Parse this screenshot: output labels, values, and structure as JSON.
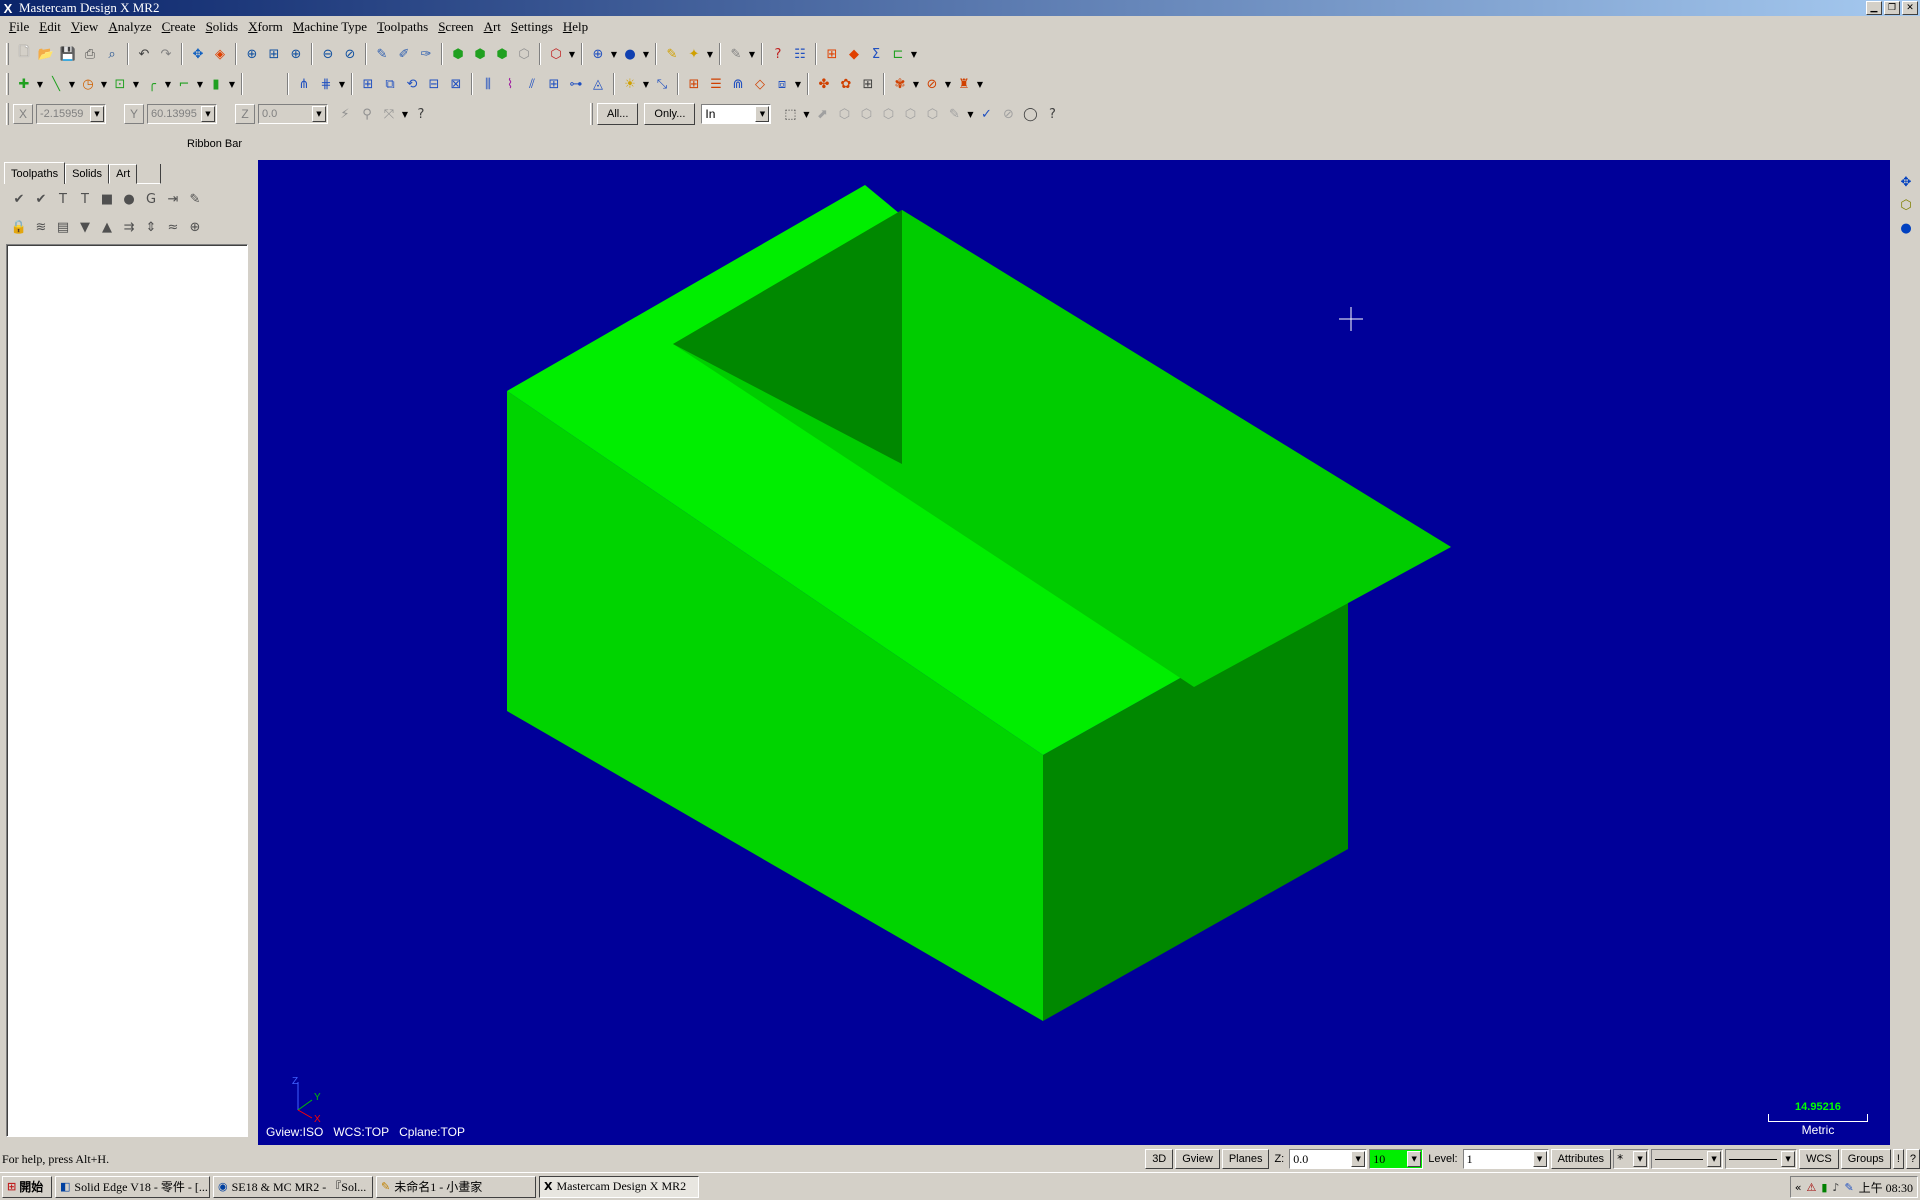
{
  "window": {
    "title": "Mastercam Design X MR2",
    "icon": "X"
  },
  "menu": [
    "File",
    "Edit",
    "View",
    "Analyze",
    "Create",
    "Solids",
    "Xform",
    "Machine Type",
    "Toolpaths",
    "Screen",
    "Art",
    "Settings",
    "Help"
  ],
  "coords": {
    "x_label": "X",
    "x_value": "-2.15959",
    "y_label": "Y",
    "y_value": "60.13995",
    "z_label": "Z",
    "z_value": "0.0"
  },
  "selection": {
    "all_button": "All...",
    "only_button": "Only...",
    "mode_value": "In"
  },
  "ribbon": {
    "label": "Ribbon Bar"
  },
  "manager": {
    "tabs": [
      "Toolpaths",
      "Solids",
      "Art"
    ]
  },
  "viewport": {
    "background": "#000099",
    "gview": "Gview:ISO",
    "wcs": "WCS:TOP",
    "cplane": "Cplane:TOP",
    "axis_x": "X",
    "axis_y": "Y",
    "axis_z": "Z",
    "scale_value": "14.95216",
    "scale_unit": "Metric",
    "model_colors": {
      "top": "#00ee00",
      "left": "#00d400",
      "right": "#008800",
      "pocket_dark": "#008800",
      "pocket_light": "#00cc00"
    }
  },
  "status": {
    "help_text": "For help, press Alt+H.",
    "btn_3d": "3D",
    "btn_gview": "Gview",
    "btn_planes": "Planes",
    "z_label": "Z:",
    "z_value": "0.0",
    "color_value": "10",
    "level_label": "Level:",
    "level_value": "1",
    "attributes": "Attributes",
    "wcs": "WCS",
    "groups": "Groups"
  },
  "taskbar": {
    "start": "開始",
    "tasks": [
      "Solid Edge V18 - 零件 - [...",
      "SE18 & MC MR2 - 『Sol...",
      "未命名1 - 小畫家",
      "Mastercam Design X MR2"
    ],
    "clock": "上午 08:30"
  }
}
